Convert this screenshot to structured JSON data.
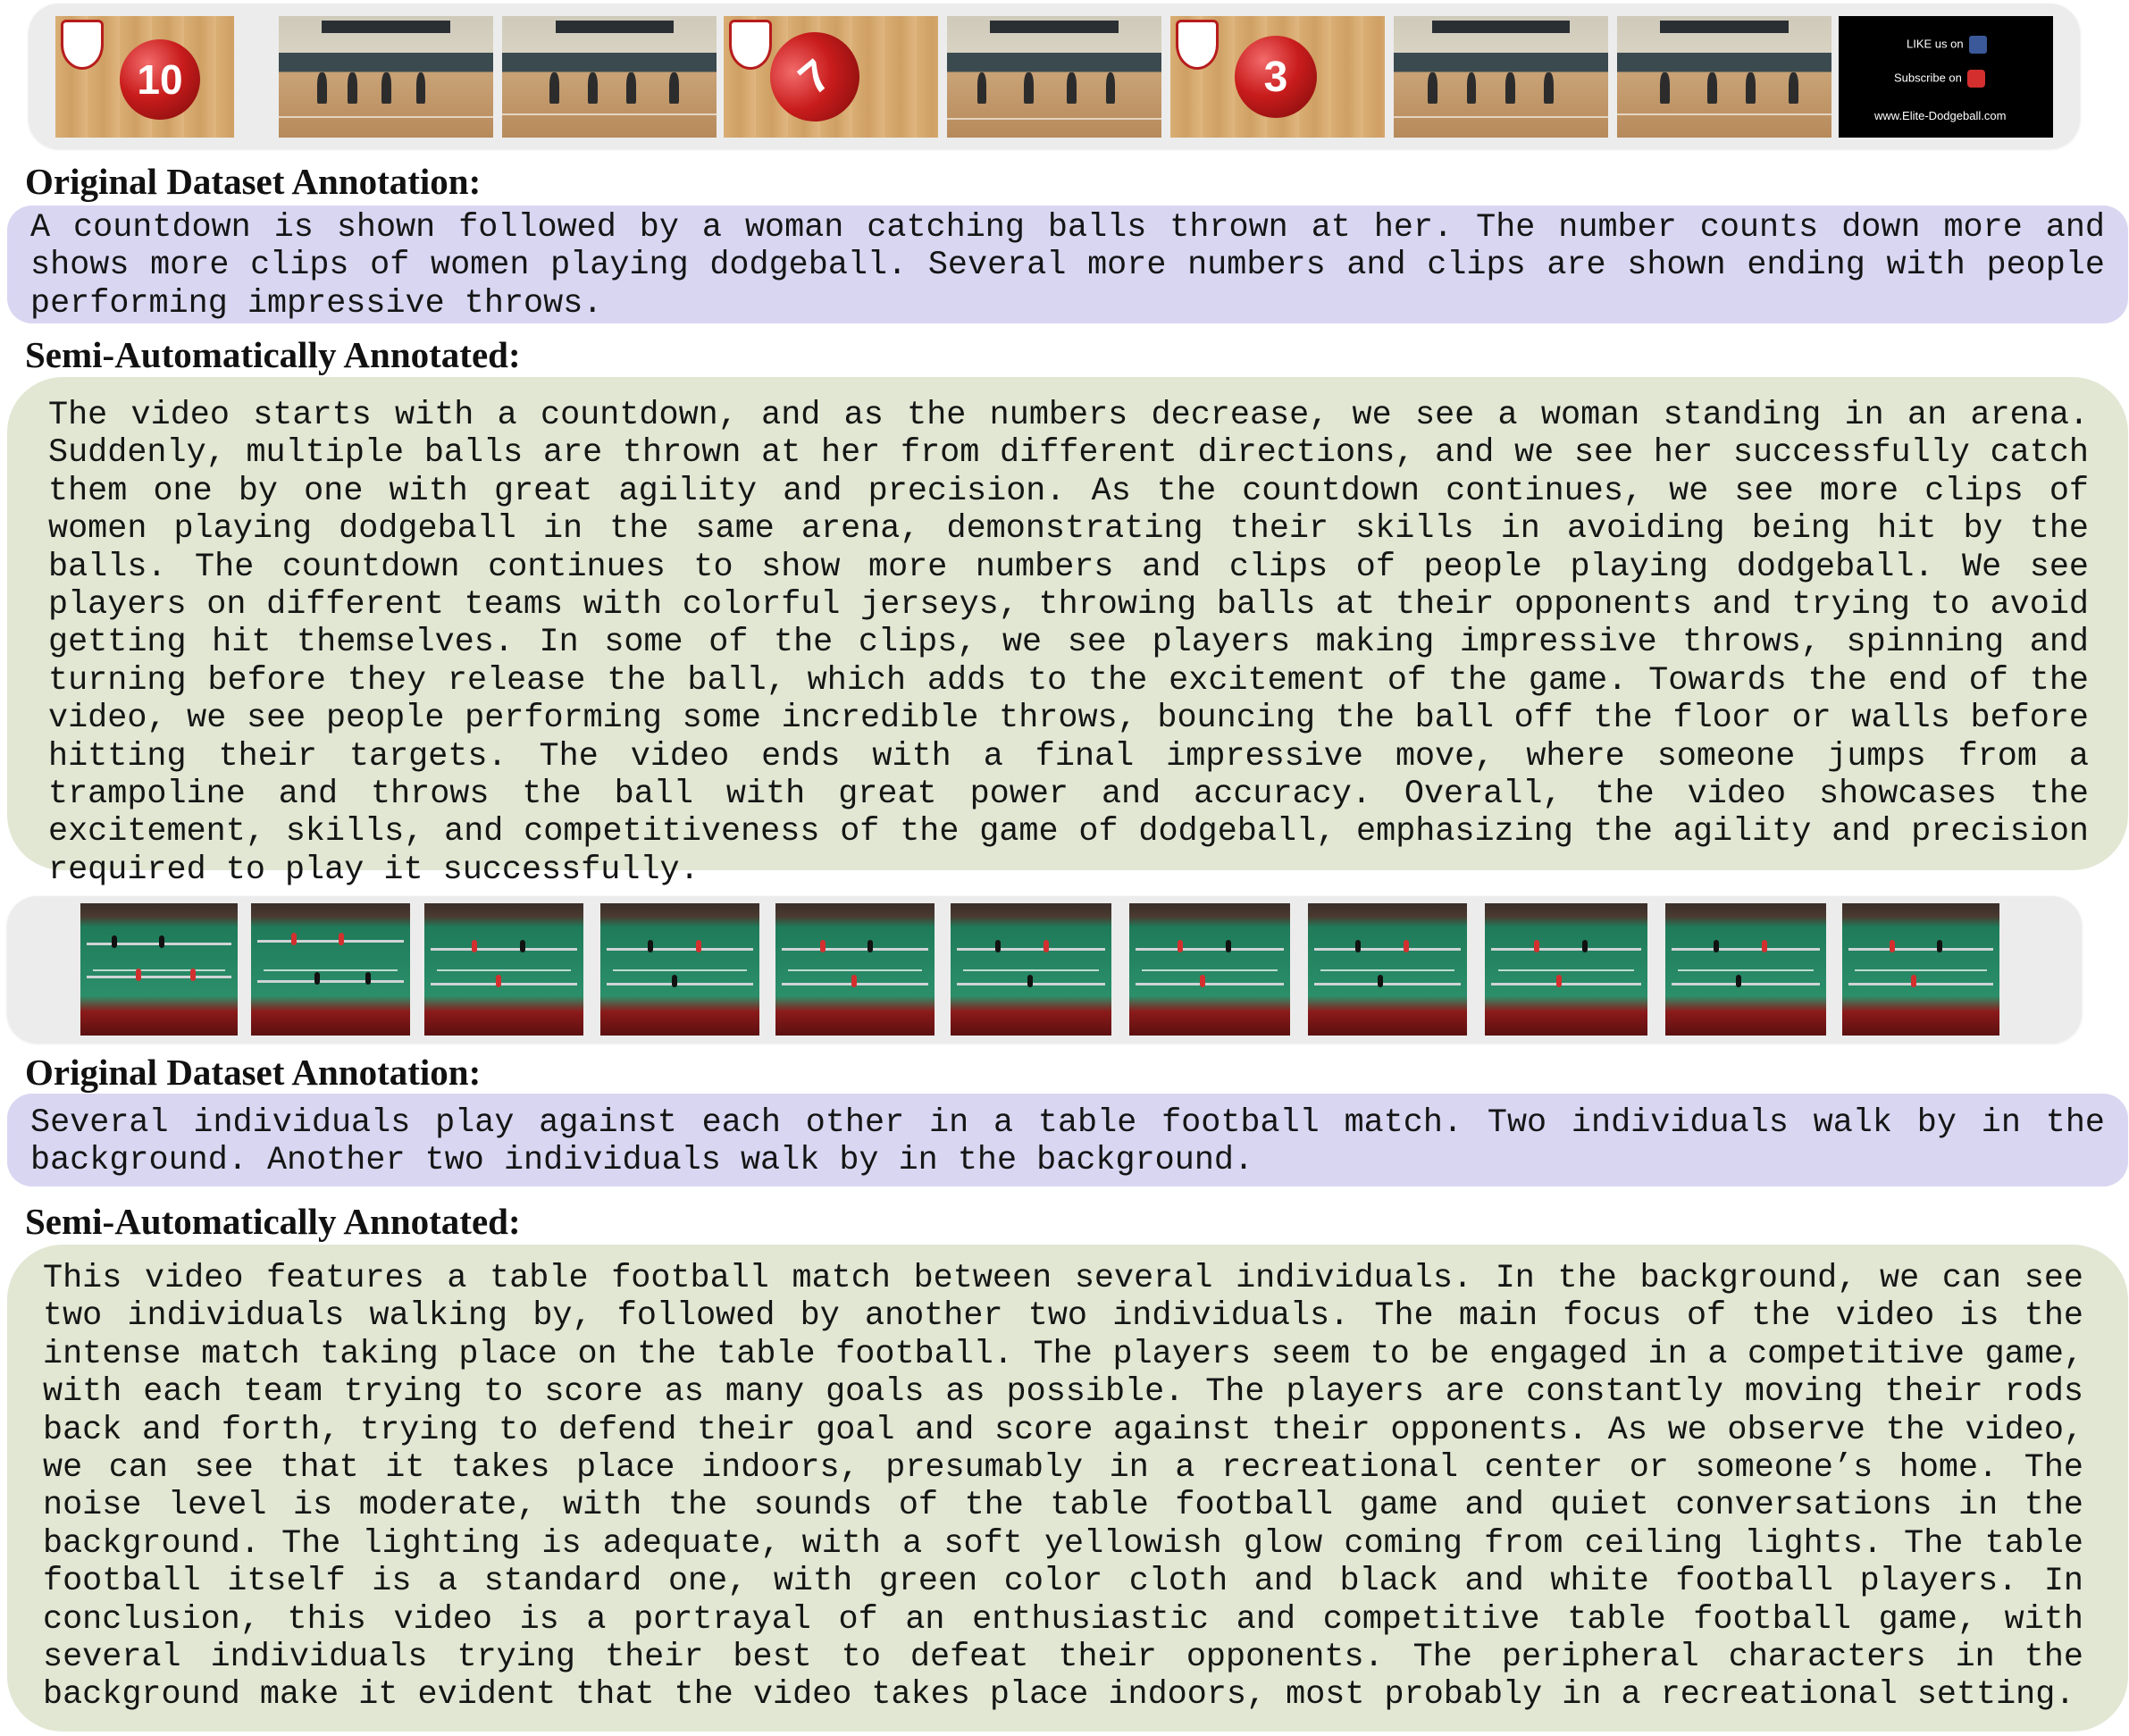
{
  "examples": [
    {
      "end_card": {
        "like_label": "LIKE us on",
        "subscribe_label": "Subscribe on",
        "url": "www.Elite-Dodgeball.com"
      },
      "countdown_numbers": [
        "10",
        "7",
        "3"
      ],
      "original_heading": "Original Dataset Annotation:",
      "original_text": "A countdown is shown followed by a woman catching balls thrown at her. The number counts down more and shows more clips of women playing dodgeball. Several more numbers and clips are shown ending with people performing impressive throws.",
      "semi_heading": "Semi-Automatically Annotated:",
      "semi_text": "The video starts with a countdown, and as the numbers decrease, we see a woman standing in an arena. Suddenly, multiple balls are thrown at her from different directions, and we see her successfully catch them one by one with great agility and precision. As the countdown continues, we see more clips of women playing dodgeball in the same arena, demonstrating their skills in avoiding being hit by the balls. The countdown continues to show more numbers and clips of people playing dodgeball. We see players on different teams with colorful jerseys, throwing balls at their opponents and trying to avoid getting hit themselves. In some of the clips, we see players making impressive throws, spinning and turning before they release the ball, which adds to the excitement of the game. Towards the end of the video, we see people performing some incredible throws, bouncing the ball off the floor or walls before hitting their targets. The video ends with a final impressive move, where someone jumps from a trampoline and throws the ball with great power and accuracy. Overall, the video showcases the excitement, skills, and competitiveness of the game of dodgeball, emphasizing the agility and precision required to play it successfully."
    },
    {
      "original_heading": "Original Dataset Annotation:",
      "original_text": "Several individuals play against each other in a table football match. Two individuals walk by in the background. Another two individuals walk by in the background.",
      "semi_heading": "Semi-Automatically Annotated:",
      "semi_text": "This video features a table football match between several individuals. In the background, we can see two individuals walking by, followed by another two individuals. The main focus of the video is the intense match taking place on the table football. The players seem to be engaged in a competitive game, with each team trying to score as many goals as possible. The players are constantly moving their rods back and forth, trying to defend their goal and score against their opponents. As we observe the video, we can see that it takes place indoors, presumably in a recreational center or someone’s home. The noise level is moderate, with the sounds of the table football game and quiet conversations in the background. The lighting is adequate, with a soft yellowish glow coming from ceiling lights. The table football itself is a standard one, with green color cloth and black and white football players. In conclusion, this video is a portrayal of an enthusiastic and competitive table football game, with several individuals trying their best to defeat their opponents. The peripheral characters in the background make it evident that the video takes place indoors, most probably in a recreational setting."
    }
  ]
}
